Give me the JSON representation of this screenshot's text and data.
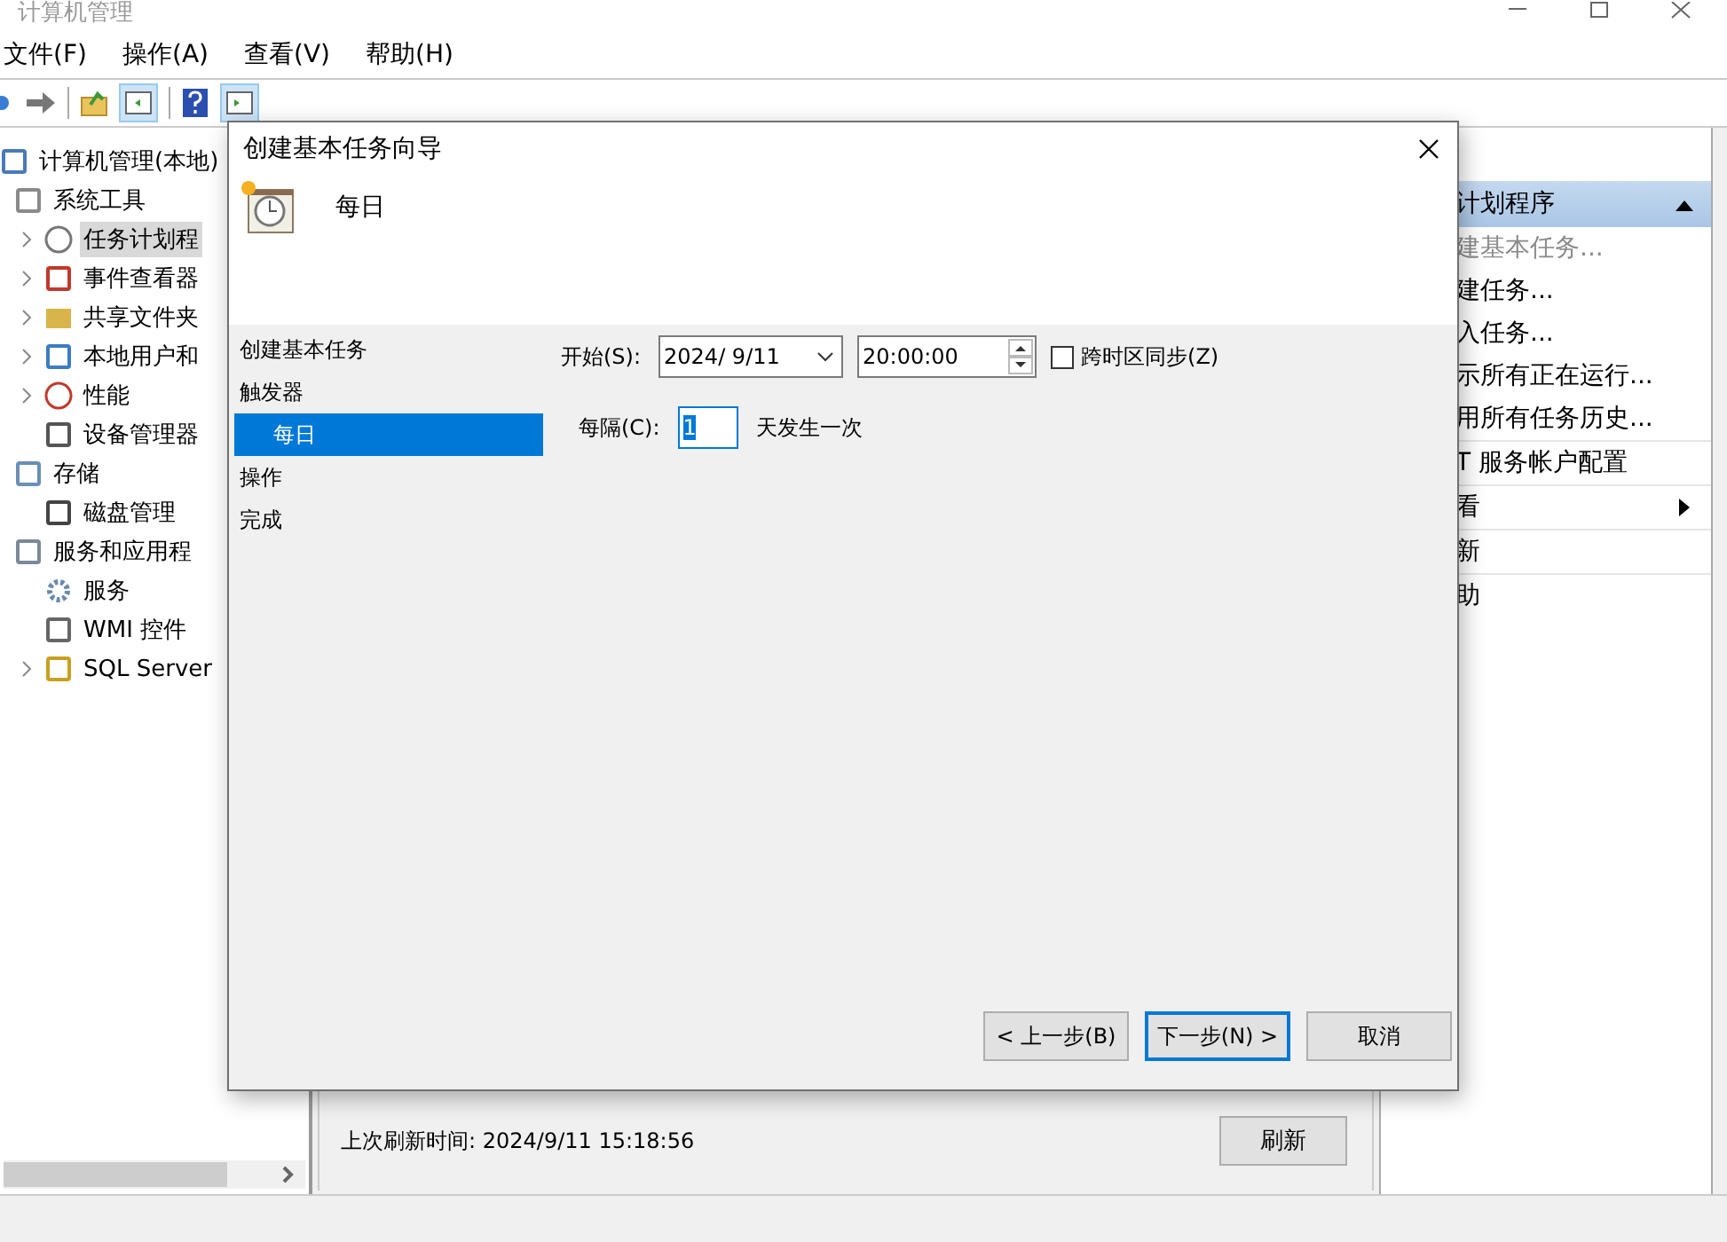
{
  "window": {
    "title": "计算机管理"
  },
  "menu": [
    {
      "label": "文件(F)"
    },
    {
      "label": "操作(A)"
    },
    {
      "label": "查看(V)"
    },
    {
      "label": "帮助(H)"
    }
  ],
  "tree": {
    "label": "计算机管理(本地)",
    "kind": "computer",
    "selected": false,
    "expandable": false,
    "children": [
      {
        "label": "系统工具",
        "kind": "tools",
        "selected": false,
        "expandable": false,
        "children": [
          {
            "label": "任务计划程",
            "kind": "clock",
            "selected": true,
            "expandable": true
          },
          {
            "label": "事件查看器",
            "kind": "event",
            "selected": false,
            "expandable": true
          },
          {
            "label": "共享文件夹",
            "kind": "folder",
            "selected": false,
            "expandable": true
          },
          {
            "label": "本地用户和",
            "kind": "users",
            "selected": false,
            "expandable": true
          },
          {
            "label": "性能",
            "kind": "perf",
            "selected": false,
            "expandable": true
          },
          {
            "label": "设备管理器",
            "kind": "device",
            "selected": false,
            "expandable": false
          }
        ]
      },
      {
        "label": "存储",
        "kind": "storage",
        "selected": false,
        "expandable": false,
        "children": [
          {
            "label": "磁盘管理",
            "kind": "disk",
            "selected": false,
            "expandable": false
          }
        ]
      },
      {
        "label": "服务和应用程",
        "kind": "server",
        "selected": false,
        "expandable": false,
        "children": [
          {
            "label": "服务",
            "kind": "gear",
            "selected": false,
            "expandable": false
          },
          {
            "label": "WMI 控件",
            "kind": "wmi",
            "selected": false,
            "expandable": false
          },
          {
            "label": "SQL Server",
            "kind": "sql",
            "selected": false,
            "expandable": true
          }
        ]
      }
    ]
  },
  "status": {
    "text": "上次刷新时间: 2024/9/11 15:18:56",
    "button": "刷新"
  },
  "actions": {
    "header": "计划程序",
    "expanded": true,
    "items": [
      {
        "label": "建基本任务...",
        "disabled": true,
        "submenu": false,
        "separator": false
      },
      {
        "label": "建任务...",
        "disabled": false,
        "submenu": false,
        "separator": false
      },
      {
        "label": "入任务...",
        "disabled": false,
        "submenu": false,
        "separator": false
      },
      {
        "label": "示所有正在运行...",
        "disabled": false,
        "submenu": false,
        "separator": false
      },
      {
        "label": "用所有任务历史...",
        "disabled": false,
        "submenu": false,
        "separator": true
      },
      {
        "label": "T 服务帐户配置",
        "disabled": false,
        "submenu": false,
        "separator": true
      },
      {
        "label": "看",
        "disabled": false,
        "submenu": true,
        "separator": true
      },
      {
        "label": "新",
        "disabled": false,
        "submenu": false,
        "separator": true
      },
      {
        "label": "助",
        "disabled": false,
        "submenu": false,
        "separator": false
      }
    ]
  },
  "dialog": {
    "title": "创建基本任务向导",
    "heading": "每日",
    "steps": [
      {
        "label": "创建基本任务",
        "selected": false
      },
      {
        "label": "触发器",
        "selected": false,
        "children": [
          {
            "label": "每日",
            "selected": true
          }
        ]
      },
      {
        "label": "操作",
        "selected": false
      },
      {
        "label": "完成",
        "selected": false
      }
    ],
    "start_label": "开始(S):",
    "date": "2024/  9/11",
    "time": "20:00:00",
    "sync": {
      "label": "跨时区同步(Z)",
      "checked": false
    },
    "every_label": "每隔(C):",
    "every_value": "1",
    "every_suffix": "天发生一次",
    "buttons": [
      {
        "label": "< 上一步(B)",
        "default": false
      },
      {
        "label": "下一步(N) >",
        "default": true
      },
      {
        "label": "取消",
        "default": false
      }
    ]
  }
}
